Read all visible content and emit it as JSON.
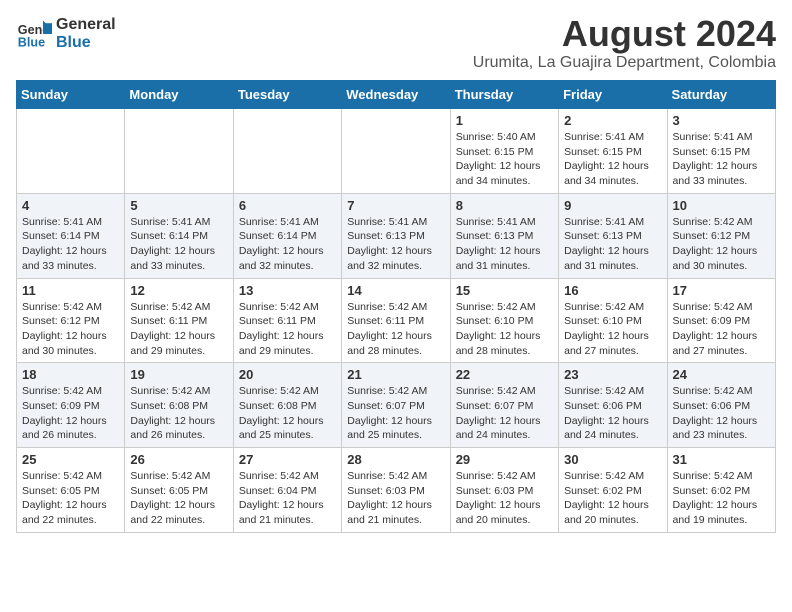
{
  "header": {
    "logo_line1": "General",
    "logo_line2": "Blue",
    "month_year": "August 2024",
    "location": "Urumita, La Guajira Department, Colombia"
  },
  "days_of_week": [
    "Sunday",
    "Monday",
    "Tuesday",
    "Wednesday",
    "Thursday",
    "Friday",
    "Saturday"
  ],
  "weeks": [
    [
      {
        "day": "",
        "info": ""
      },
      {
        "day": "",
        "info": ""
      },
      {
        "day": "",
        "info": ""
      },
      {
        "day": "",
        "info": ""
      },
      {
        "day": "1",
        "info": "Sunrise: 5:40 AM\nSunset: 6:15 PM\nDaylight: 12 hours\nand 34 minutes."
      },
      {
        "day": "2",
        "info": "Sunrise: 5:41 AM\nSunset: 6:15 PM\nDaylight: 12 hours\nand 34 minutes."
      },
      {
        "day": "3",
        "info": "Sunrise: 5:41 AM\nSunset: 6:15 PM\nDaylight: 12 hours\nand 33 minutes."
      }
    ],
    [
      {
        "day": "4",
        "info": "Sunrise: 5:41 AM\nSunset: 6:14 PM\nDaylight: 12 hours\nand 33 minutes."
      },
      {
        "day": "5",
        "info": "Sunrise: 5:41 AM\nSunset: 6:14 PM\nDaylight: 12 hours\nand 33 minutes."
      },
      {
        "day": "6",
        "info": "Sunrise: 5:41 AM\nSunset: 6:14 PM\nDaylight: 12 hours\nand 32 minutes."
      },
      {
        "day": "7",
        "info": "Sunrise: 5:41 AM\nSunset: 6:13 PM\nDaylight: 12 hours\nand 32 minutes."
      },
      {
        "day": "8",
        "info": "Sunrise: 5:41 AM\nSunset: 6:13 PM\nDaylight: 12 hours\nand 31 minutes."
      },
      {
        "day": "9",
        "info": "Sunrise: 5:41 AM\nSunset: 6:13 PM\nDaylight: 12 hours\nand 31 minutes."
      },
      {
        "day": "10",
        "info": "Sunrise: 5:42 AM\nSunset: 6:12 PM\nDaylight: 12 hours\nand 30 minutes."
      }
    ],
    [
      {
        "day": "11",
        "info": "Sunrise: 5:42 AM\nSunset: 6:12 PM\nDaylight: 12 hours\nand 30 minutes."
      },
      {
        "day": "12",
        "info": "Sunrise: 5:42 AM\nSunset: 6:11 PM\nDaylight: 12 hours\nand 29 minutes."
      },
      {
        "day": "13",
        "info": "Sunrise: 5:42 AM\nSunset: 6:11 PM\nDaylight: 12 hours\nand 29 minutes."
      },
      {
        "day": "14",
        "info": "Sunrise: 5:42 AM\nSunset: 6:11 PM\nDaylight: 12 hours\nand 28 minutes."
      },
      {
        "day": "15",
        "info": "Sunrise: 5:42 AM\nSunset: 6:10 PM\nDaylight: 12 hours\nand 28 minutes."
      },
      {
        "day": "16",
        "info": "Sunrise: 5:42 AM\nSunset: 6:10 PM\nDaylight: 12 hours\nand 27 minutes."
      },
      {
        "day": "17",
        "info": "Sunrise: 5:42 AM\nSunset: 6:09 PM\nDaylight: 12 hours\nand 27 minutes."
      }
    ],
    [
      {
        "day": "18",
        "info": "Sunrise: 5:42 AM\nSunset: 6:09 PM\nDaylight: 12 hours\nand 26 minutes."
      },
      {
        "day": "19",
        "info": "Sunrise: 5:42 AM\nSunset: 6:08 PM\nDaylight: 12 hours\nand 26 minutes."
      },
      {
        "day": "20",
        "info": "Sunrise: 5:42 AM\nSunset: 6:08 PM\nDaylight: 12 hours\nand 25 minutes."
      },
      {
        "day": "21",
        "info": "Sunrise: 5:42 AM\nSunset: 6:07 PM\nDaylight: 12 hours\nand 25 minutes."
      },
      {
        "day": "22",
        "info": "Sunrise: 5:42 AM\nSunset: 6:07 PM\nDaylight: 12 hours\nand 24 minutes."
      },
      {
        "day": "23",
        "info": "Sunrise: 5:42 AM\nSunset: 6:06 PM\nDaylight: 12 hours\nand 24 minutes."
      },
      {
        "day": "24",
        "info": "Sunrise: 5:42 AM\nSunset: 6:06 PM\nDaylight: 12 hours\nand 23 minutes."
      }
    ],
    [
      {
        "day": "25",
        "info": "Sunrise: 5:42 AM\nSunset: 6:05 PM\nDaylight: 12 hours\nand 22 minutes."
      },
      {
        "day": "26",
        "info": "Sunrise: 5:42 AM\nSunset: 6:05 PM\nDaylight: 12 hours\nand 22 minutes."
      },
      {
        "day": "27",
        "info": "Sunrise: 5:42 AM\nSunset: 6:04 PM\nDaylight: 12 hours\nand 21 minutes."
      },
      {
        "day": "28",
        "info": "Sunrise: 5:42 AM\nSunset: 6:03 PM\nDaylight: 12 hours\nand 21 minutes."
      },
      {
        "day": "29",
        "info": "Sunrise: 5:42 AM\nSunset: 6:03 PM\nDaylight: 12 hours\nand 20 minutes."
      },
      {
        "day": "30",
        "info": "Sunrise: 5:42 AM\nSunset: 6:02 PM\nDaylight: 12 hours\nand 20 minutes."
      },
      {
        "day": "31",
        "info": "Sunrise: 5:42 AM\nSunset: 6:02 PM\nDaylight: 12 hours\nand 19 minutes."
      }
    ]
  ]
}
